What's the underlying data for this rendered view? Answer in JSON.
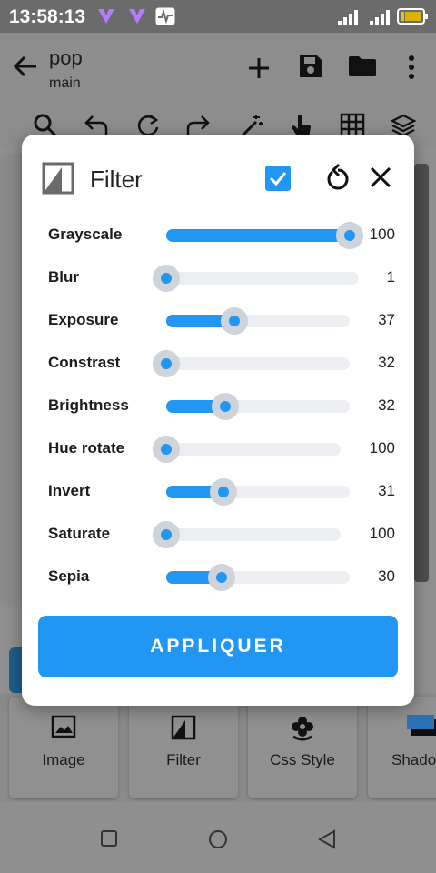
{
  "status_bar": {
    "time": "13:58:13"
  },
  "app_bar": {
    "title": "pop",
    "subtitle": "main"
  },
  "dialog": {
    "title": "Filter",
    "apply_label": "APPLIQUER",
    "accent": "#2196f3",
    "filters": [
      {
        "name": "Grayscale",
        "value": "100",
        "level": 1.0,
        "track_end": 385
      },
      {
        "name": "Blur",
        "value": "1",
        "level": 0.0,
        "track_end": 395
      },
      {
        "name": "Exposure",
        "value": "37",
        "level": 0.37,
        "track_end": 385
      },
      {
        "name": "Constrast",
        "value": "32",
        "level": 0.0,
        "track_end": 385
      },
      {
        "name": "Brightness",
        "value": "32",
        "level": 0.32,
        "track_end": 385
      },
      {
        "name": "Hue rotate",
        "value": "100",
        "level": 0.0,
        "track_end": 375
      },
      {
        "name": "Invert",
        "value": "31",
        "level": 0.31,
        "track_end": 385
      },
      {
        "name": "Saturate",
        "value": "100",
        "level": 0.0,
        "track_end": 375
      },
      {
        "name": "Sepia",
        "value": "30",
        "level": 0.3,
        "track_end": 385
      }
    ]
  },
  "bottom_cards": [
    {
      "label": "Image",
      "icon": "image-icon"
    },
    {
      "label": "Filter",
      "icon": "filter-icon"
    },
    {
      "label": "Css Style",
      "icon": "flower-icon"
    },
    {
      "label": "Shado",
      "icon": "shadow-icon"
    }
  ]
}
